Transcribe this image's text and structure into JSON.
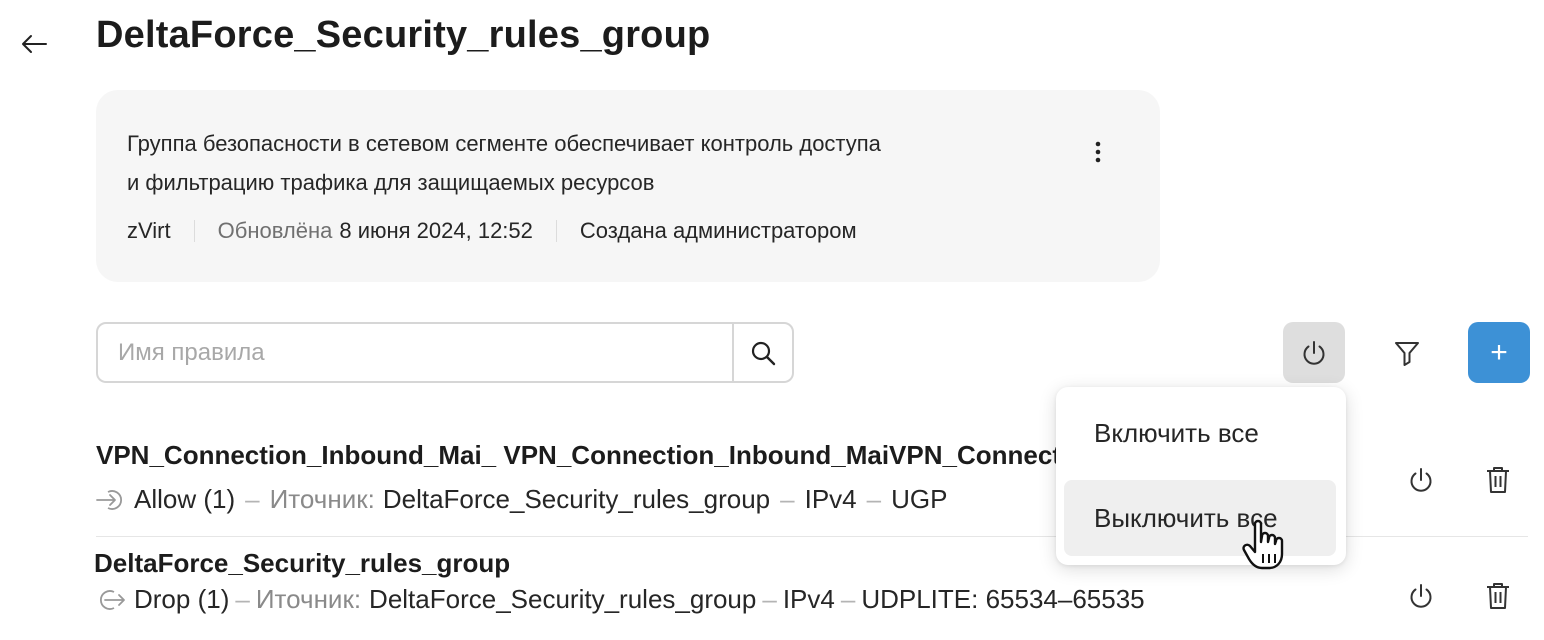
{
  "header": {
    "back_icon": "arrow-left-icon",
    "title": "DeltaForce_Security_rules_group"
  },
  "info_card": {
    "description_line1": "Группа безопасности в сетевом сегменте обеспечивает контроль доступа",
    "description_line2": "и фильтрацию трафика для защищаемых ресурсов",
    "menu_icon": "more-vertical-icon",
    "platform": "zVirt",
    "updated_label": "Обновлёна",
    "updated_value": "8 июня 2024, 12:52",
    "created_by": "Создана администратором"
  },
  "toolbar": {
    "search_placeholder": "Имя правила",
    "search_value": "",
    "search_icon": "search-icon",
    "power_icon": "power-icon",
    "filter_icon": "filter-icon",
    "add_label": "+",
    "add_color": "#3d91d6"
  },
  "dropdown": {
    "items": [
      {
        "label": "Включить все"
      },
      {
        "label": "Выключить все"
      }
    ]
  },
  "rules": [
    {
      "name": "VPN_Connection_Inbound_Mai_ VPN_Connection_Inbound_MaiVPN_Connection_Inbound",
      "direction_icon": "inbound-arrow-icon",
      "action": "Allow (1)",
      "source_label": "Иточник:",
      "source": "DeltaForce_Security_rules_group",
      "ip_version": "IPv4",
      "protocol": "UGP"
    },
    {
      "name": "DeltaForce_Security_rules_group",
      "direction_icon": "outbound-arrow-icon",
      "action": "Drop (1)",
      "source_label": "Иточник:",
      "source": "DeltaForce_Security_rules_group",
      "ip_version": "IPv4",
      "protocol": "UDPLITE: 65534–65535"
    }
  ],
  "separator": "–"
}
